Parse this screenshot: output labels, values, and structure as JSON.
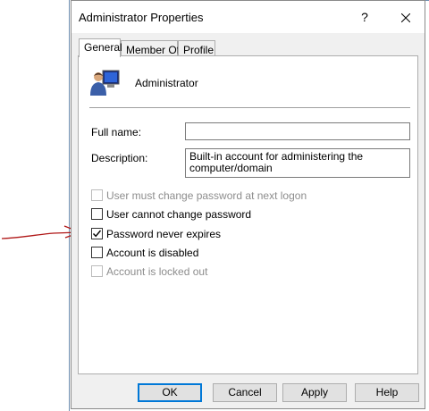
{
  "window": {
    "title": "Administrator Properties",
    "help_label": "?",
    "close_label": "✕"
  },
  "tabs": [
    {
      "label": "General",
      "active": true
    },
    {
      "label": "Member Of",
      "active": false
    },
    {
      "label": "Profile",
      "active": false
    }
  ],
  "account": {
    "icon": "user-monitor-icon",
    "name": "Administrator"
  },
  "fields": {
    "full_name": {
      "label": "Full name:",
      "value": ""
    },
    "description": {
      "label": "Description:",
      "value": "Built-in account for administering the computer/domain"
    }
  },
  "options": [
    {
      "label": "User must change password at next logon",
      "checked": false,
      "enabled": false
    },
    {
      "label": "User cannot change password",
      "checked": false,
      "enabled": true
    },
    {
      "label": "Password never expires",
      "checked": true,
      "enabled": true
    },
    {
      "label": "Account is disabled",
      "checked": false,
      "enabled": true
    },
    {
      "label": "Account is locked out",
      "checked": false,
      "enabled": false
    }
  ],
  "buttons": {
    "ok": "OK",
    "cancel": "Cancel",
    "apply": "Apply",
    "help": "Help"
  },
  "colors": {
    "focus_border": "#0078d7",
    "annotation_arrow": "#b01818"
  }
}
